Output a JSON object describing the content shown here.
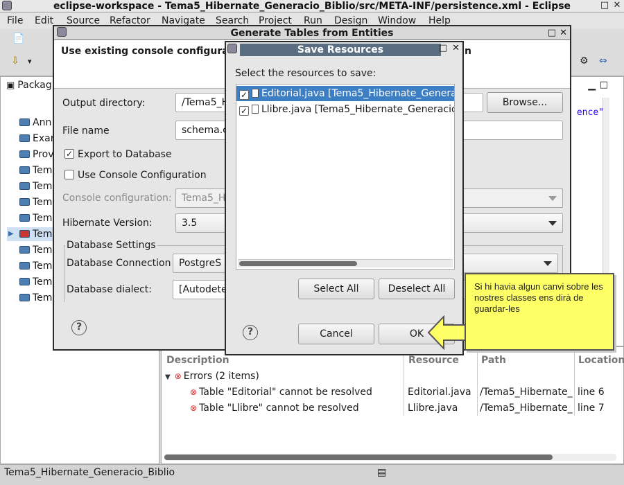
{
  "window": {
    "title": "eclipse-workspace - Tema5_Hibernate_Generacio_Biblio/src/META-INF/persistence.xml - Eclipse"
  },
  "menu": [
    "File",
    "Edit",
    "Source",
    "Refactor",
    "Navigate",
    "Search",
    "Project",
    "Run",
    "Design",
    "Window",
    "Help"
  ],
  "package_explorer": {
    "tab": "Packag",
    "items": [
      "Ann",
      "Exar",
      "Prov",
      "Tem",
      "Tem",
      "Tem",
      "Tem",
      "Tem",
      "Tem",
      "Tem",
      "Tem",
      "Tem"
    ]
  },
  "editor": {
    "snippet": "ence\""
  },
  "problems": {
    "columns": [
      "Description",
      "Resource",
      "Path",
      "Location"
    ],
    "group": "Errors (2 items)",
    "rows": [
      {
        "description": "Table \"Editorial\" cannot be resolved",
        "resource": "Editorial.java",
        "path": "/Tema5_Hibernate_",
        "location": "line 6"
      },
      {
        "description": "Table \"Llibre\" cannot be resolved",
        "resource": "Llibre.java",
        "path": "/Tema5_Hibernate_",
        "location": "line 7"
      }
    ]
  },
  "status_bar": {
    "text": "Tema5_Hibernate_Generacio_Biblio"
  },
  "generate_dialog": {
    "title": "Generate Tables from Entities",
    "header": "Use existing console configurati",
    "header_tail": "n",
    "output_directory_label": "Output directory:",
    "output_directory_value": "/Tema5_H",
    "browse_label": "Browse...",
    "file_name_label": "File name",
    "file_name_value": "schema.c",
    "export_label": "Export to Database",
    "use_console_label": "Use Console Configuration",
    "console_config_label": "Console configuration:",
    "console_config_value": "Tema5_H",
    "hibernate_version_label": "Hibernate Version:",
    "hibernate_version_value": "3.5",
    "db_settings_label": "Database Settings",
    "db_connection_label": "Database Connection",
    "db_connection_value": "PostgreS",
    "db_dialect_label": "Database dialect:",
    "db_dialect_value": "[Autodete"
  },
  "save_dialog": {
    "title": "Save Resources",
    "prompt": "Select the resources to save:",
    "resources": [
      {
        "name": "Editorial.java  [Tema5_Hibernate_Genera",
        "checked": true,
        "selected": true
      },
      {
        "name": "Llibre.java  [Tema5_Hibernate_Generacio",
        "checked": true,
        "selected": false
      }
    ],
    "select_all": "Select All",
    "deselect_all": "Deselect All",
    "cancel": "Cancel",
    "ok": "OK"
  },
  "callout": {
    "text": "Si hi havia algun canvi sobre les nostres classes ens dirà de guardar-les",
    "color": "#ffff66"
  }
}
